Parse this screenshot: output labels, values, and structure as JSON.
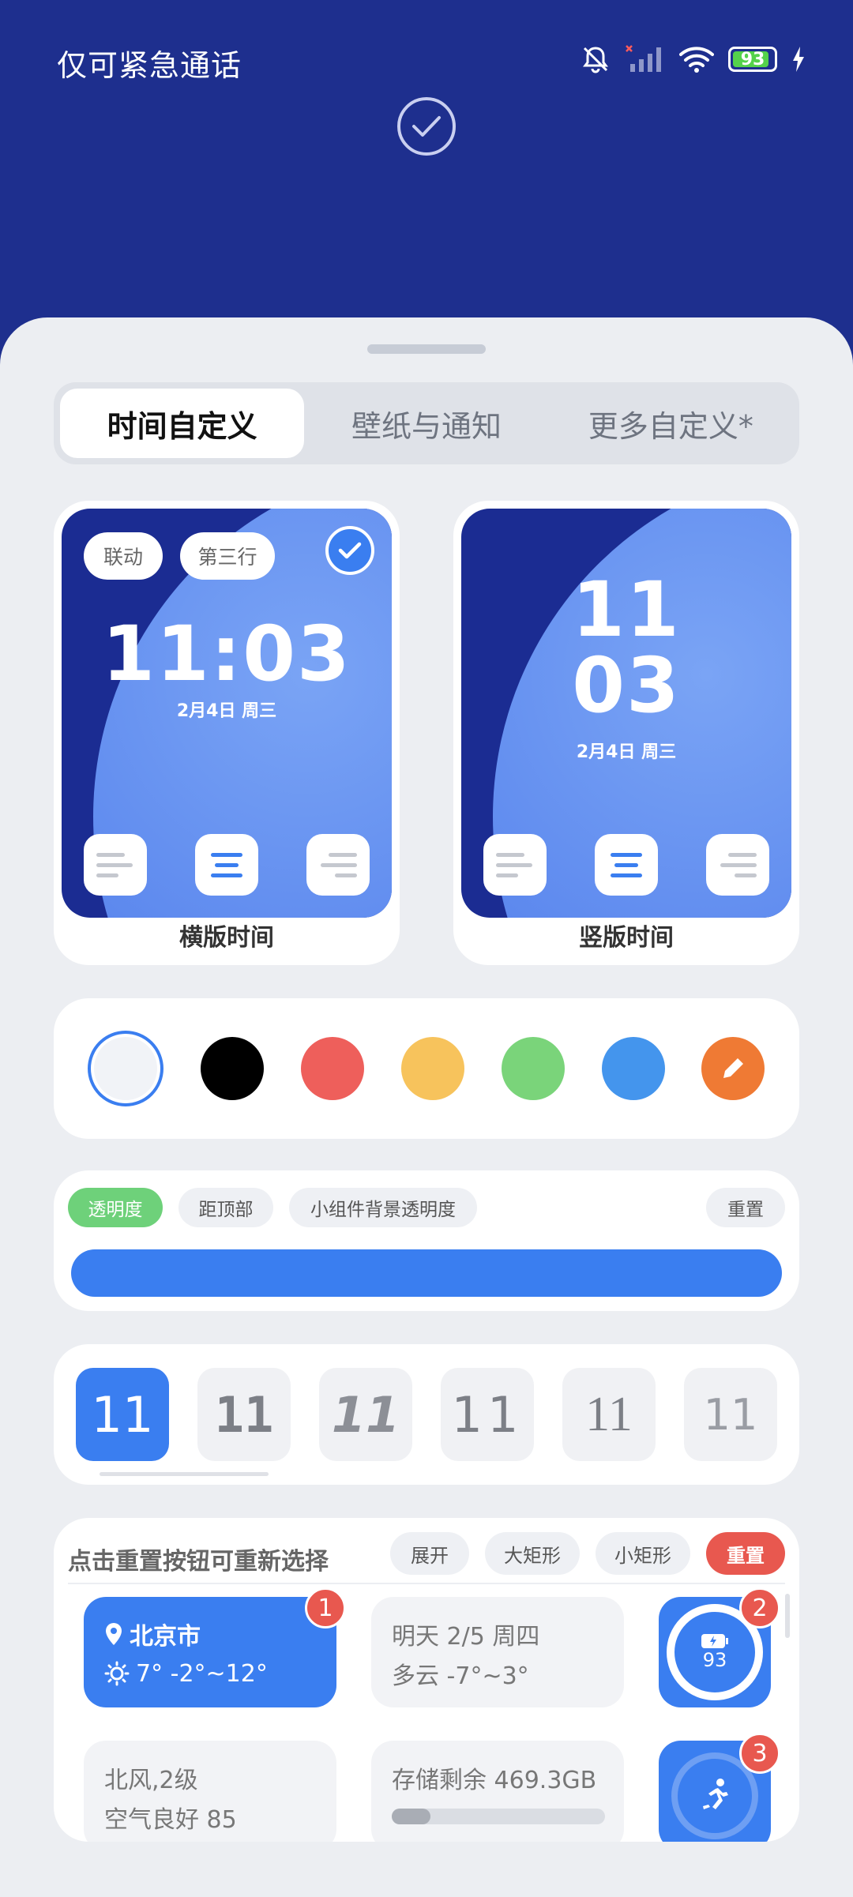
{
  "status_bar": {
    "carrier_text": "仅可紧急通话",
    "battery": "93",
    "icons": [
      "mute-icon",
      "no-signal-icon",
      "wifi-icon",
      "battery-icon",
      "charging-icon"
    ]
  },
  "tabs": [
    {
      "label": "时间自定义",
      "active": true
    },
    {
      "label": "壁纸与通知",
      "active": false
    },
    {
      "label": "更多自定义*",
      "active": false
    }
  ],
  "previews": {
    "horizontal": {
      "chip_1": "联动",
      "chip_2": "第三行",
      "time": "11:03",
      "date": "2月4日 周三",
      "label": "横版时间",
      "selected": true
    },
    "vertical": {
      "hour": "11",
      "minute": "03",
      "date": "2月4日 周三",
      "label": "竖版时间",
      "selected": false
    }
  },
  "color_swatches": [
    "#f1f3f7",
    "#000000",
    "#ee5f5b",
    "#f7c35c",
    "#7ad47a",
    "#4495ed",
    "#ef7a34"
  ],
  "selected_swatch": "#f1f3f7",
  "slider": {
    "chips": [
      "透明度",
      "距顶部",
      "小组件背景透明度"
    ],
    "reset": "重置",
    "value_percent": 100
  },
  "font_styles": [
    "11",
    "11",
    "11",
    "11",
    "11",
    "11"
  ],
  "widgets": {
    "hint": "点击重置按钮可重新选择",
    "chips": [
      "展开",
      "大矩形",
      "小矩形",
      "重置"
    ],
    "weather": {
      "badge": "1",
      "city": "北京市",
      "temp": "7° -2°~12°"
    },
    "forecast": {
      "line1": "明天 2/5 周四",
      "line2": "多云 -7°~3°"
    },
    "battery": {
      "badge": "2",
      "value": "93"
    },
    "air": {
      "line1": "北风,2级",
      "line2": "空气良好 85"
    },
    "storage": {
      "label": "存储剩余 469.3GB"
    },
    "sport": {
      "badge": "3"
    }
  }
}
